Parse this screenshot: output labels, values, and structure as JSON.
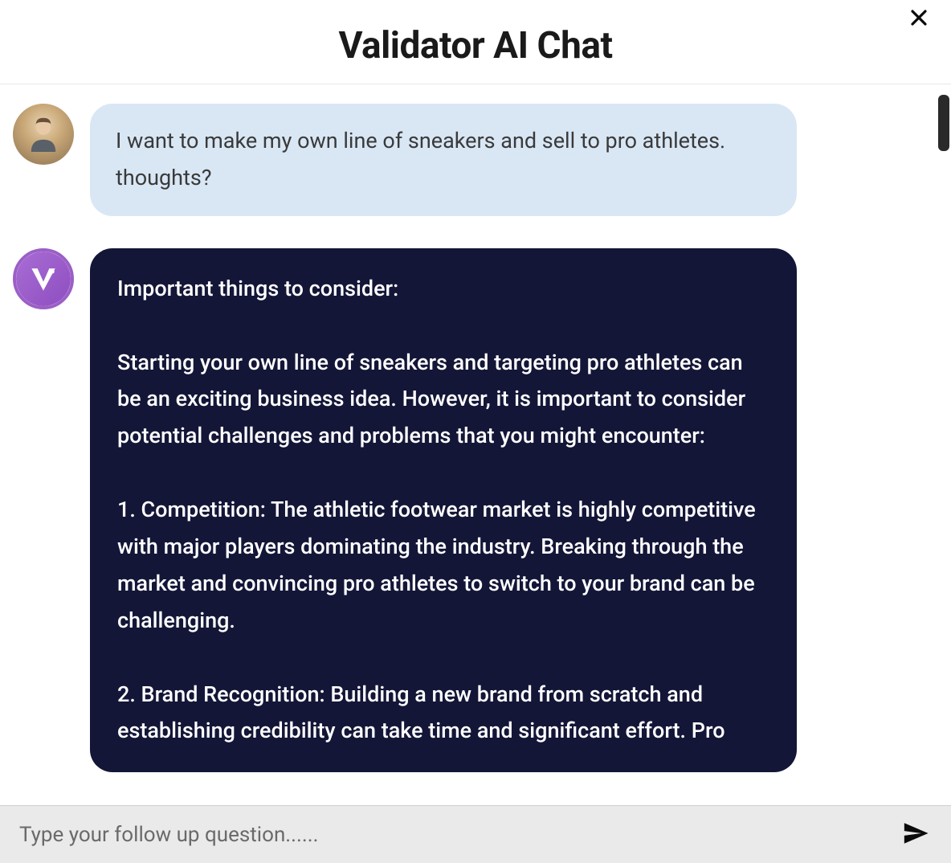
{
  "header": {
    "title": "Validator AI Chat"
  },
  "messages": {
    "user": {
      "text": "I want to make my own line of sneakers and sell to pro athletes. thoughts?"
    },
    "bot": {
      "text": "Important things to consider:\n\nStarting your own line of sneakers and targeting pro athletes can be an exciting business idea. However, it is important to consider potential challenges and problems that you might encounter:\n\n1. Competition: The athletic footwear market is highly competitive with major players dominating the industry. Breaking through the market and convincing pro athletes to switch to your brand can be challenging.\n\n2. Brand Recognition: Building a new brand from scratch and establishing credibility can take time and significant effort. Pro"
    }
  },
  "input": {
    "placeholder": "Type your follow up question......"
  },
  "icons": {
    "close": "close-icon",
    "send": "paper-plane-icon",
    "user_avatar": "user-avatar",
    "bot_avatar": "validator-logo"
  },
  "bot_logo_letter": "V"
}
